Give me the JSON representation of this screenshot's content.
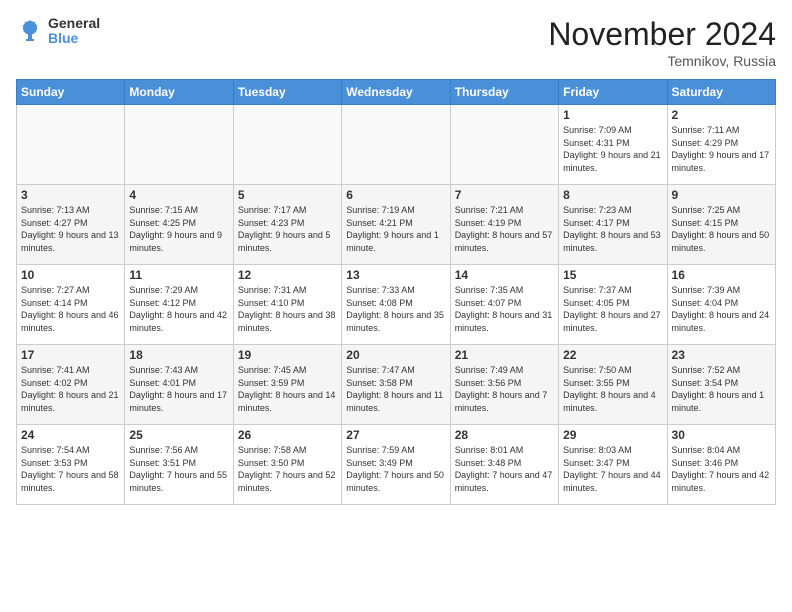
{
  "header": {
    "logo_general": "General",
    "logo_blue": "Blue",
    "month_title": "November 2024",
    "subtitle": "Temnikov, Russia"
  },
  "days_of_week": [
    "Sunday",
    "Monday",
    "Tuesday",
    "Wednesday",
    "Thursday",
    "Friday",
    "Saturday"
  ],
  "weeks": [
    [
      {
        "day": "",
        "info": ""
      },
      {
        "day": "",
        "info": ""
      },
      {
        "day": "",
        "info": ""
      },
      {
        "day": "",
        "info": ""
      },
      {
        "day": "",
        "info": ""
      },
      {
        "day": "1",
        "info": "Sunrise: 7:09 AM\nSunset: 4:31 PM\nDaylight: 9 hours and 21 minutes."
      },
      {
        "day": "2",
        "info": "Sunrise: 7:11 AM\nSunset: 4:29 PM\nDaylight: 9 hours and 17 minutes."
      }
    ],
    [
      {
        "day": "3",
        "info": "Sunrise: 7:13 AM\nSunset: 4:27 PM\nDaylight: 9 hours and 13 minutes."
      },
      {
        "day": "4",
        "info": "Sunrise: 7:15 AM\nSunset: 4:25 PM\nDaylight: 9 hours and 9 minutes."
      },
      {
        "day": "5",
        "info": "Sunrise: 7:17 AM\nSunset: 4:23 PM\nDaylight: 9 hours and 5 minutes."
      },
      {
        "day": "6",
        "info": "Sunrise: 7:19 AM\nSunset: 4:21 PM\nDaylight: 9 hours and 1 minute."
      },
      {
        "day": "7",
        "info": "Sunrise: 7:21 AM\nSunset: 4:19 PM\nDaylight: 8 hours and 57 minutes."
      },
      {
        "day": "8",
        "info": "Sunrise: 7:23 AM\nSunset: 4:17 PM\nDaylight: 8 hours and 53 minutes."
      },
      {
        "day": "9",
        "info": "Sunrise: 7:25 AM\nSunset: 4:15 PM\nDaylight: 8 hours and 50 minutes."
      }
    ],
    [
      {
        "day": "10",
        "info": "Sunrise: 7:27 AM\nSunset: 4:14 PM\nDaylight: 8 hours and 46 minutes."
      },
      {
        "day": "11",
        "info": "Sunrise: 7:29 AM\nSunset: 4:12 PM\nDaylight: 8 hours and 42 minutes."
      },
      {
        "day": "12",
        "info": "Sunrise: 7:31 AM\nSunset: 4:10 PM\nDaylight: 8 hours and 38 minutes."
      },
      {
        "day": "13",
        "info": "Sunrise: 7:33 AM\nSunset: 4:08 PM\nDaylight: 8 hours and 35 minutes."
      },
      {
        "day": "14",
        "info": "Sunrise: 7:35 AM\nSunset: 4:07 PM\nDaylight: 8 hours and 31 minutes."
      },
      {
        "day": "15",
        "info": "Sunrise: 7:37 AM\nSunset: 4:05 PM\nDaylight: 8 hours and 27 minutes."
      },
      {
        "day": "16",
        "info": "Sunrise: 7:39 AM\nSunset: 4:04 PM\nDaylight: 8 hours and 24 minutes."
      }
    ],
    [
      {
        "day": "17",
        "info": "Sunrise: 7:41 AM\nSunset: 4:02 PM\nDaylight: 8 hours and 21 minutes."
      },
      {
        "day": "18",
        "info": "Sunrise: 7:43 AM\nSunset: 4:01 PM\nDaylight: 8 hours and 17 minutes."
      },
      {
        "day": "19",
        "info": "Sunrise: 7:45 AM\nSunset: 3:59 PM\nDaylight: 8 hours and 14 minutes."
      },
      {
        "day": "20",
        "info": "Sunrise: 7:47 AM\nSunset: 3:58 PM\nDaylight: 8 hours and 11 minutes."
      },
      {
        "day": "21",
        "info": "Sunrise: 7:49 AM\nSunset: 3:56 PM\nDaylight: 8 hours and 7 minutes."
      },
      {
        "day": "22",
        "info": "Sunrise: 7:50 AM\nSunset: 3:55 PM\nDaylight: 8 hours and 4 minutes."
      },
      {
        "day": "23",
        "info": "Sunrise: 7:52 AM\nSunset: 3:54 PM\nDaylight: 8 hours and 1 minute."
      }
    ],
    [
      {
        "day": "24",
        "info": "Sunrise: 7:54 AM\nSunset: 3:53 PM\nDaylight: 7 hours and 58 minutes."
      },
      {
        "day": "25",
        "info": "Sunrise: 7:56 AM\nSunset: 3:51 PM\nDaylight: 7 hours and 55 minutes."
      },
      {
        "day": "26",
        "info": "Sunrise: 7:58 AM\nSunset: 3:50 PM\nDaylight: 7 hours and 52 minutes."
      },
      {
        "day": "27",
        "info": "Sunrise: 7:59 AM\nSunset: 3:49 PM\nDaylight: 7 hours and 50 minutes."
      },
      {
        "day": "28",
        "info": "Sunrise: 8:01 AM\nSunset: 3:48 PM\nDaylight: 7 hours and 47 minutes."
      },
      {
        "day": "29",
        "info": "Sunrise: 8:03 AM\nSunset: 3:47 PM\nDaylight: 7 hours and 44 minutes."
      },
      {
        "day": "30",
        "info": "Sunrise: 8:04 AM\nSunset: 3:46 PM\nDaylight: 7 hours and 42 minutes."
      }
    ]
  ]
}
